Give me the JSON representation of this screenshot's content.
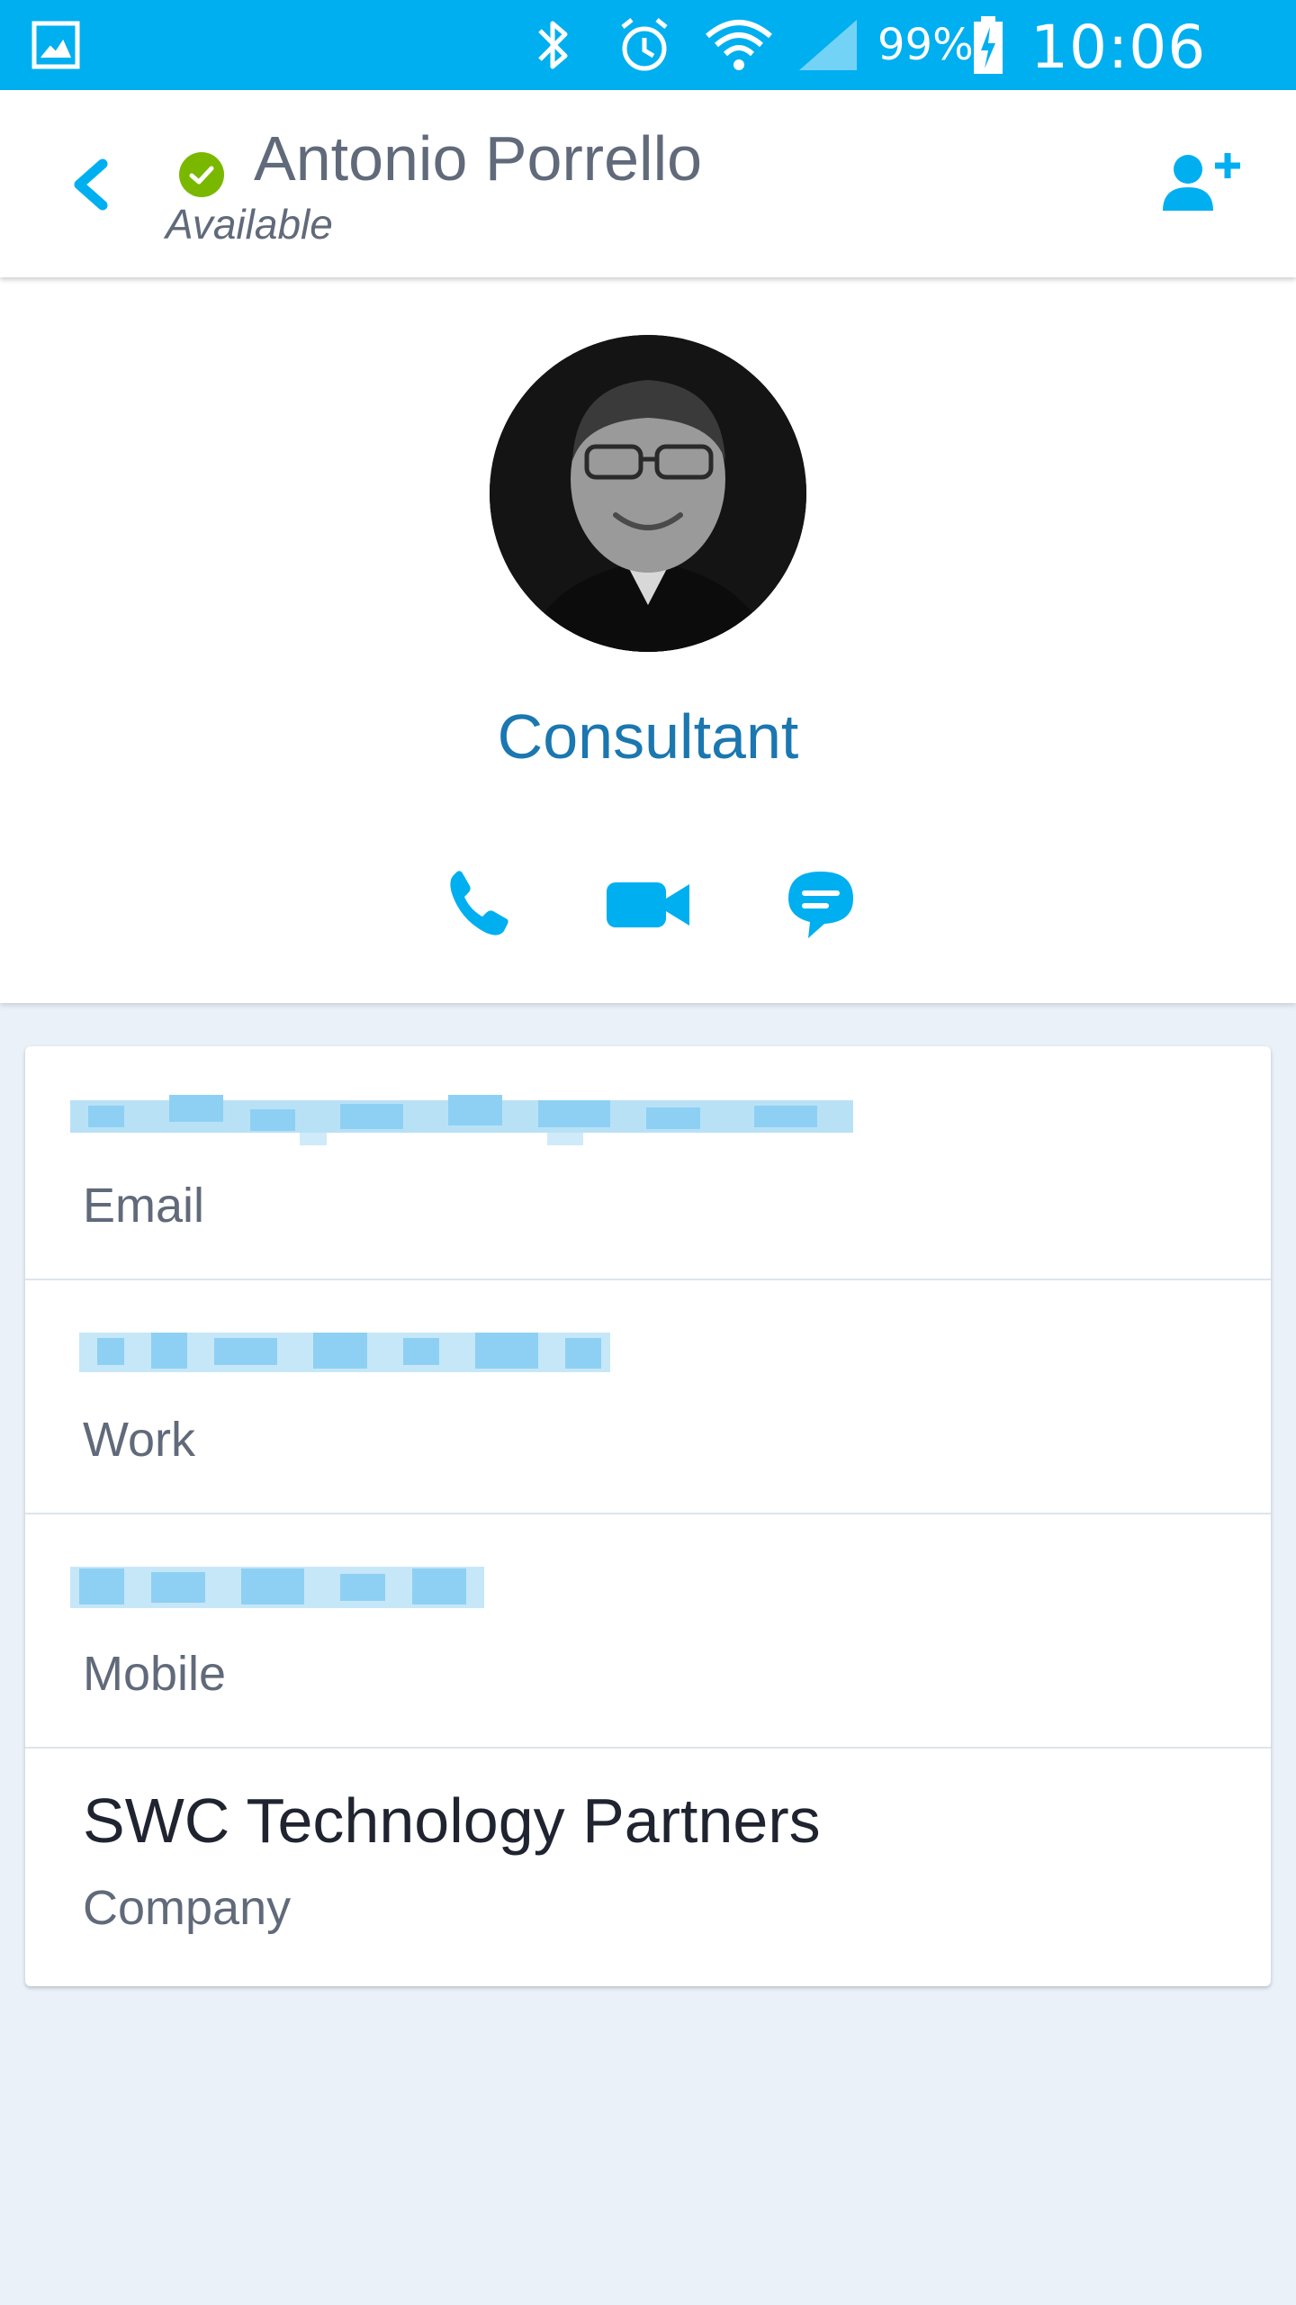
{
  "status_bar": {
    "battery_percent": "99%",
    "time": "10:06 PM",
    "icons": [
      "gallery-icon",
      "bluetooth-icon",
      "alarm-icon",
      "wifi-icon",
      "signal-icon",
      "battery-charging-icon"
    ]
  },
  "header": {
    "contact_name": "Antonio Porrello",
    "presence_status": "Available",
    "colors": {
      "accent": "#00aff0",
      "presence": "#7ab800"
    }
  },
  "profile": {
    "role": "Consultant",
    "actions": [
      "phone-icon",
      "video-icon",
      "chat-icon"
    ]
  },
  "details": {
    "rows": [
      {
        "label": "Email"
      },
      {
        "label": "Work"
      },
      {
        "label": "Mobile"
      },
      {
        "value": "SWC Technology Partners",
        "label": "Company"
      }
    ]
  }
}
